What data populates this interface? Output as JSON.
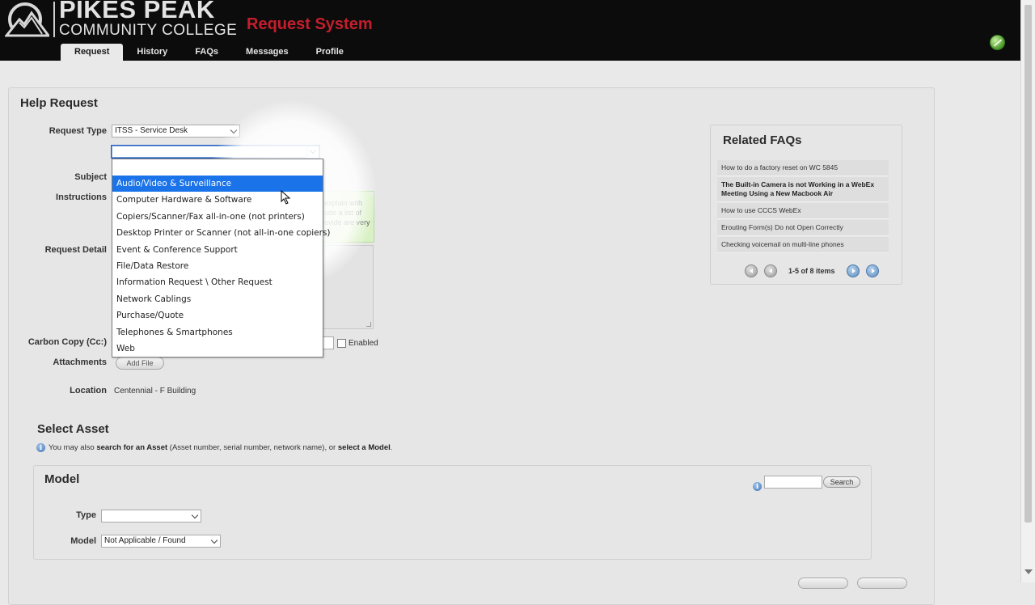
{
  "header": {
    "brand_line1": "PIKES PEAK",
    "brand_line2": "COMMUNITY COLLEGE",
    "app_title": "Request System",
    "tabs": [
      {
        "label": "Request",
        "active": true
      },
      {
        "label": "History",
        "active": false
      },
      {
        "label": "FAQs",
        "active": false
      },
      {
        "label": "Messages",
        "active": false
      },
      {
        "label": "Profile",
        "active": false
      }
    ]
  },
  "form": {
    "title": "Help Request",
    "request_type_label": "Request Type",
    "request_type_value": "ITSS - Service Desk",
    "subject_label": "Subject",
    "instructions_label": "Instructions",
    "instructions_text": "explain with ude a list of ovide are very",
    "request_detail_label": "Request Detail",
    "cc_label": "Carbon Copy (Cc:)",
    "enabled_label": "Enabled",
    "attachments_label": "Attachments",
    "add_file_label": "Add File",
    "location_label": "Location",
    "location_value": "Centennial - F Building"
  },
  "dropdown": {
    "options": [
      "Audio/Video & Surveillance",
      "Computer Hardware & Software",
      "Copiers/Scanner/Fax all-in-one (not printers)",
      "Desktop Printer or Scanner (not all-in-one copiers)",
      "Event & Conference Support",
      "File/Data Restore",
      "Information Request \\ Other Request",
      "Network Cablings",
      "Purchase/Quote",
      "Telephones & Smartphones",
      "Web"
    ],
    "selected_index": 0
  },
  "faqs": {
    "title": "Related FAQs",
    "items": [
      "How to do a factory reset on WC 5845",
      "The Built-in Camera is not Working in a WebEx Meeting Using a New Macbook Air",
      "How to use CCCS WebEx",
      "Erouting Form(s) Do not Open Correctly",
      "Checking voicemail on multi-line phones"
    ],
    "pager_text": "1-5 of 8 items"
  },
  "asset": {
    "title": "Select Asset",
    "hint_prefix": "You may also ",
    "hint_bold1": "search for an Asset",
    "hint_mid": " (Asset number, serial number, network name), or ",
    "hint_bold2": "select a Model",
    "hint_suffix": ".",
    "model_title": "Model",
    "search_label": "Search",
    "type_label": "Type",
    "type_value": "",
    "model_label": "Model",
    "model_value": "Not Applicable / Found"
  },
  "colors": {
    "header_bg": "#0c0c0c",
    "app_title": "#c41e2c",
    "selected_option": "#1a73e8",
    "note_bg": "#d8f0c3"
  }
}
